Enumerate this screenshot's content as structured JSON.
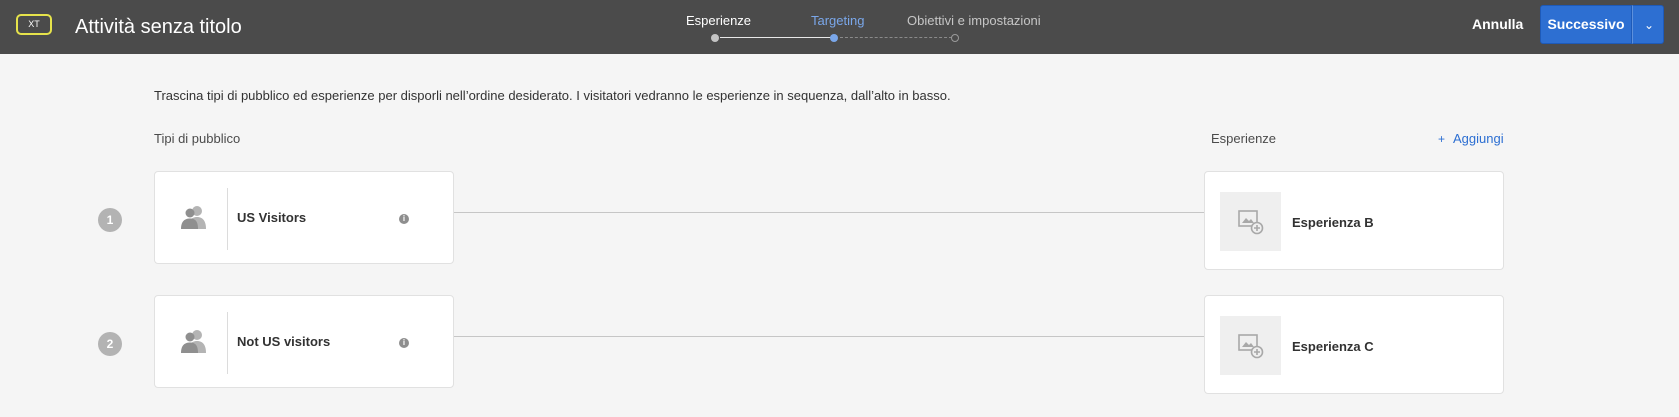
{
  "header": {
    "badge": "XT",
    "title": "Attività senza titolo",
    "steps": [
      {
        "label": "Esperienze",
        "state": "completed"
      },
      {
        "label": "Targeting",
        "state": "current"
      },
      {
        "label": "Obiettivi e impostazioni",
        "state": "upcoming"
      }
    ],
    "cancel_label": "Annulla",
    "next_label": "Successivo",
    "colors": {
      "bar": "#4b4b4b",
      "accent": "#2d6fd2",
      "current_step": "#7aa7ea",
      "badge_border": "#e6e34b"
    }
  },
  "content": {
    "instructions": "Trascina tipi di pubblico ed esperienze per disporli nell’ordine desiderato. I visitatori vedranno le esperienze in sequenza, dall’alto in basso.",
    "audiences_label": "Tipi di pubblico",
    "experiences_label": "Esperienze",
    "add_label": "Aggiungi",
    "add_icon": "+",
    "info_icon": "i",
    "rows": [
      {
        "number": "1",
        "audience": "US Visitors",
        "experience": "Esperienza B"
      },
      {
        "number": "2",
        "audience": "Not US visitors",
        "experience": "Esperienza C"
      }
    ]
  }
}
